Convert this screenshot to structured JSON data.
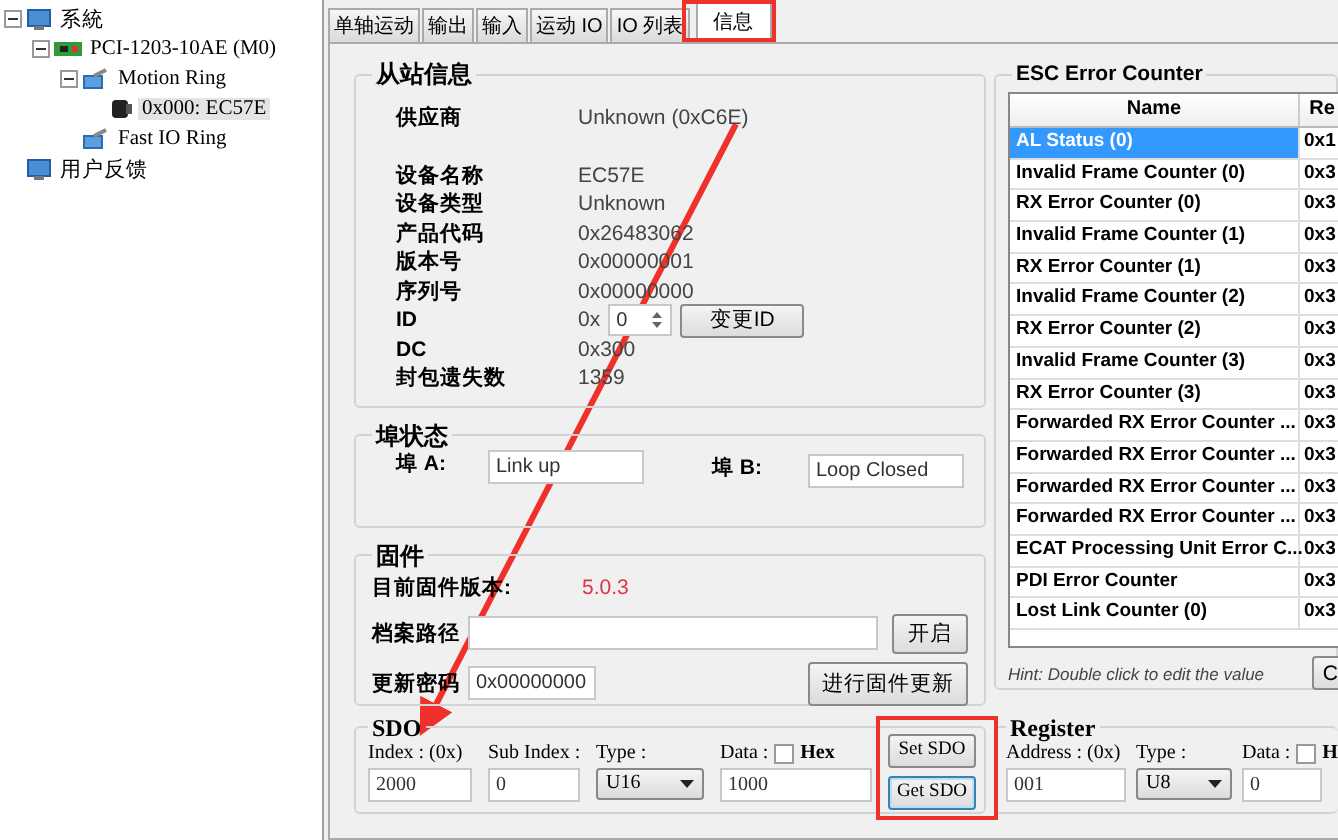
{
  "tree": [
    {
      "label": "系統",
      "kind": "system",
      "expanded": true,
      "selected": false,
      "children": [
        {
          "label": "PCI-1203-10AE (M0)",
          "kind": "card",
          "expanded": true,
          "selected": false,
          "children": [
            {
              "label": "Motion Ring",
              "kind": "ring",
              "expanded": true,
              "selected": false,
              "children": [
                {
                  "label": "0x000: EC57E",
                  "kind": "device",
                  "selected": true
                }
              ]
            },
            {
              "label": "Fast IO Ring",
              "kind": "ring",
              "selected": false
            }
          ]
        }
      ]
    },
    {
      "label": "用户反馈",
      "kind": "system",
      "selected": false
    }
  ],
  "tabs": [
    {
      "label": "单轴运动",
      "selected": false
    },
    {
      "label": "输出",
      "selected": false
    },
    {
      "label": "输入",
      "selected": false
    },
    {
      "label": "运动 IO",
      "selected": false
    },
    {
      "label": "IO 列表",
      "selected": false
    },
    {
      "label": "信息",
      "selected": true
    }
  ],
  "slave_info": {
    "title": "从站信息",
    "fields": [
      {
        "kind": "text",
        "label": "供应商",
        "value": "Unknown (0xC6E)"
      },
      {
        "kind": "text",
        "label": "设备名称",
        "value": "EC57E"
      },
      {
        "kind": "text",
        "label": "设备类型",
        "value": "Unknown"
      },
      {
        "kind": "text",
        "label": "产品代码",
        "value": "0x26483062"
      },
      {
        "kind": "text",
        "label": "版本号",
        "value": "0x00000001"
      },
      {
        "kind": "text",
        "label": "序列号",
        "value": "0x00000000"
      },
      {
        "kind": "id",
        "label": "ID",
        "prefix": "0x",
        "value": "0",
        "button": "变更ID"
      },
      {
        "kind": "text",
        "label": "DC",
        "value": "0x300"
      },
      {
        "kind": "text",
        "label": "封包遗失数",
        "value": "1359"
      }
    ]
  },
  "port_status": {
    "title": "埠状态",
    "ports": [
      {
        "label": "埠 A:",
        "value": "Link up"
      },
      {
        "label": "埠 B:",
        "value": "Loop Closed"
      }
    ]
  },
  "firmware": {
    "title": "固件",
    "version_label": "目前固件版本:",
    "version": "5.0.3",
    "path_label": "档案路径",
    "open_button": "开启",
    "password_label": "更新密码",
    "password": "0x00000000",
    "update_button": "进行固件更新"
  },
  "sdo": {
    "title": "SDO",
    "index_label": "Index :  (0x)",
    "index": "2000",
    "subindex_label": "Sub Index :",
    "subindex": "0",
    "type_label": "Type :",
    "type": "U16",
    "data_label": "Data :",
    "hex_checked": false,
    "hex_label": "Hex",
    "data": "1000",
    "buttons": [
      {
        "label": "Set SDO",
        "focused": false
      },
      {
        "label": "Get SDO",
        "focused": true
      }
    ]
  },
  "esc_error_counter": {
    "title": "ESC Error Counter",
    "table": {
      "columns": [
        "Name",
        "Re"
      ],
      "rows": [
        {
          "name": "AL Status (0)",
          "value": "0x1",
          "selected": true
        },
        {
          "name": "Invalid Frame Counter (0)",
          "value": "0x3",
          "selected": false
        },
        {
          "name": "RX Error Counter (0)",
          "value": "0x3",
          "selected": false
        },
        {
          "name": "Invalid Frame Counter (1)",
          "value": "0x3",
          "selected": false
        },
        {
          "name": "RX Error Counter (1)",
          "value": "0x3",
          "selected": false
        },
        {
          "name": "Invalid Frame Counter (2)",
          "value": "0x3",
          "selected": false
        },
        {
          "name": "RX Error Counter (2)",
          "value": "0x3",
          "selected": false
        },
        {
          "name": "Invalid Frame Counter (3)",
          "value": "0x3",
          "selected": false
        },
        {
          "name": "RX Error Counter (3)",
          "value": "0x3",
          "selected": false
        },
        {
          "name": "Forwarded RX Error Counter ...",
          "value": "0x3",
          "selected": false
        },
        {
          "name": "Forwarded RX Error Counter ...",
          "value": "0x3",
          "selected": false
        },
        {
          "name": "Forwarded RX Error Counter ...",
          "value": "0x3",
          "selected": false
        },
        {
          "name": "Forwarded RX Error Counter ...",
          "value": "0x3",
          "selected": false
        },
        {
          "name": "ECAT Processing Unit Error C...",
          "value": "0x3",
          "selected": false
        },
        {
          "name": "PDI Error Counter",
          "value": "0x3",
          "selected": false
        },
        {
          "name": "Lost Link Counter (0)",
          "value": "0x3",
          "selected": false
        }
      ]
    },
    "hint": "Hint: Double click to edit the value",
    "button": "C"
  },
  "register": {
    "title": "Register",
    "address_label": "Address :  (0x)",
    "address": "001",
    "type_label": "Type :",
    "type": "U8",
    "data_label": "Data :",
    "hex_checked": false,
    "hex_label": "H",
    "data": "0"
  }
}
